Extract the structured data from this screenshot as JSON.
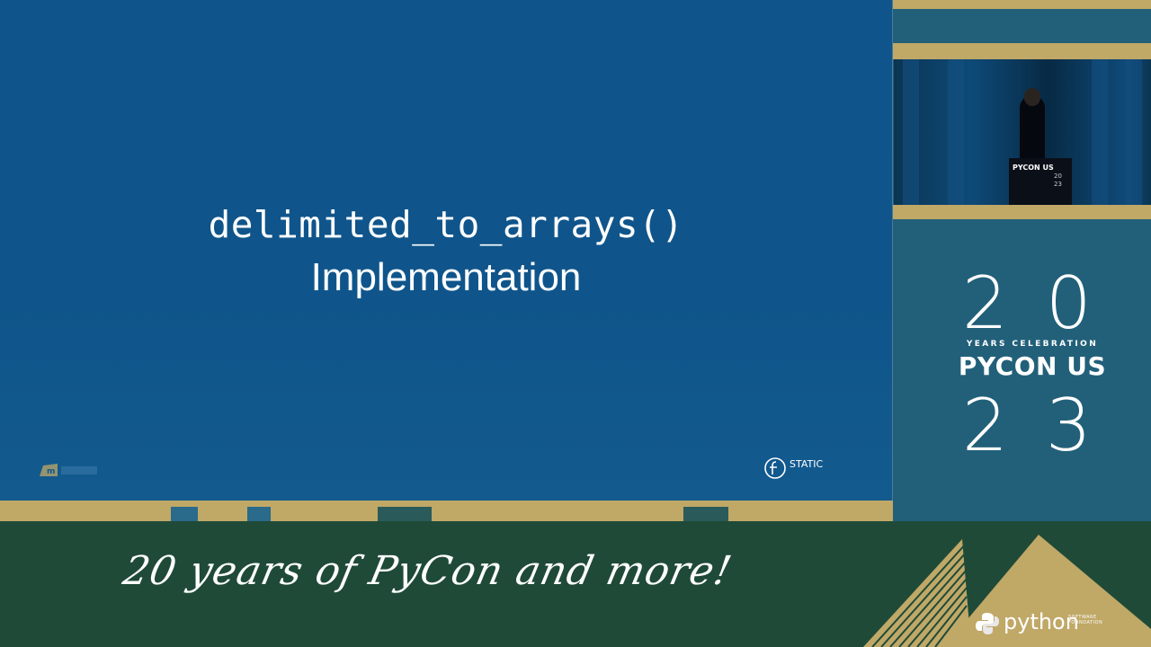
{
  "slide": {
    "code_title": "delimited_to_arrays()",
    "subtitle": "Implementation",
    "corner_logo_right": "STATIC"
  },
  "video": {
    "podium_label": "PYCON US",
    "podium_year": "20\n23"
  },
  "brand": {
    "year_top": "20",
    "years_celebration": "YEARS CELEBRATION",
    "event_name": "PYCON US",
    "year_bottom": "23"
  },
  "footer": {
    "tagline": "20 years of PyCon and more!",
    "psf_name": "python",
    "psf_sub": "SOFTWARE\nFOUNDATION"
  },
  "colors": {
    "slide_bg": "#0f558b",
    "gold": "#c0a867",
    "footer_bg": "#1f4a38",
    "right_bg": "#22607a"
  }
}
